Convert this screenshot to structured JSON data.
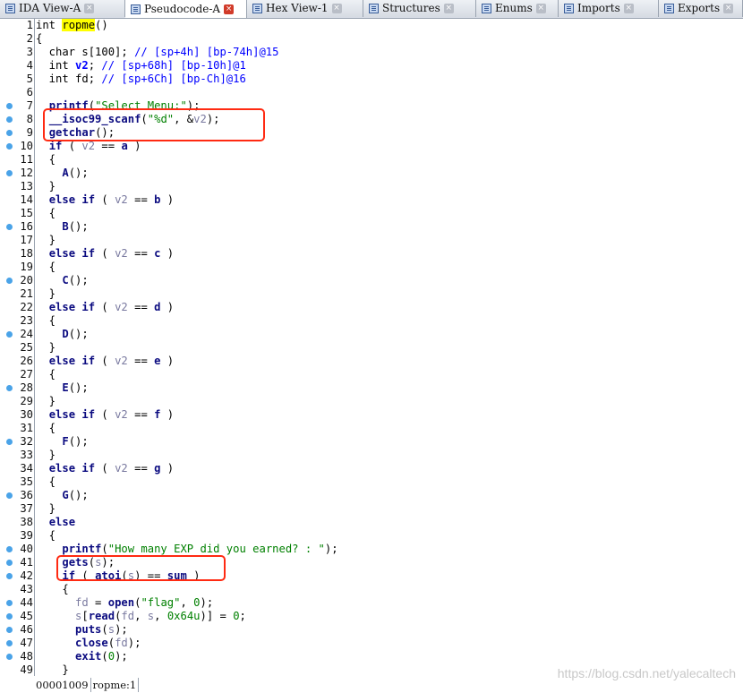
{
  "tabs": [
    {
      "label": "IDA View-A",
      "active": false,
      "icon": "ida-view-icon"
    },
    {
      "label": "Pseudocode-A",
      "active": true,
      "icon": "pseudocode-icon"
    },
    {
      "label": "Hex View-1",
      "active": false,
      "icon": "hex-view-icon"
    },
    {
      "label": "Structures",
      "active": false,
      "icon": "structures-icon"
    },
    {
      "label": "Enums",
      "active": false,
      "icon": "enums-icon"
    },
    {
      "label": "Imports",
      "active": false,
      "icon": "imports-icon"
    },
    {
      "label": "Exports",
      "active": false,
      "icon": "exports-icon"
    }
  ],
  "breakpoint_color": "#4aa3e8",
  "highlight_color": "#ff2a12",
  "lines": [
    {
      "n": "1",
      "dot": false,
      "code": [
        [
          "pn",
          "int "
        ],
        [
          "hl",
          "ropme"
        ],
        [
          "pn",
          "()"
        ]
      ]
    },
    {
      "n": "2",
      "dot": false,
      "code": [
        [
          "pn",
          "{"
        ]
      ]
    },
    {
      "n": "3",
      "dot": false,
      "code": [
        [
          "pn",
          "  char s[100]; "
        ],
        [
          "cmt",
          "// [sp+4h] [bp-74h]@15"
        ]
      ]
    },
    {
      "n": "4",
      "dot": false,
      "code": [
        [
          "pn",
          "  int "
        ],
        [
          "var",
          "v2"
        ],
        [
          "pn",
          "; "
        ],
        [
          "cmt",
          "// [sp+68h] [bp-10h]@1"
        ]
      ]
    },
    {
      "n": "5",
      "dot": false,
      "code": [
        [
          "pn",
          "  int fd; "
        ],
        [
          "cmt",
          "// [sp+6Ch] [bp-Ch]@16"
        ]
      ]
    },
    {
      "n": "6",
      "dot": false,
      "code": []
    },
    {
      "n": "7",
      "dot": true,
      "code": [
        [
          "pn",
          "  "
        ],
        [
          "fn",
          "printf"
        ],
        [
          "pn",
          "("
        ],
        [
          "str",
          "\"Select Menu:\""
        ],
        [
          "pn",
          ");"
        ]
      ]
    },
    {
      "n": "8",
      "dot": true,
      "code": [
        [
          "pn",
          "  "
        ],
        [
          "fn",
          "__isoc99_scanf"
        ],
        [
          "pn",
          "("
        ],
        [
          "str",
          "\"%d\""
        ],
        [
          "pn",
          ", &"
        ],
        [
          "lvar",
          "v2"
        ],
        [
          "pn",
          ");"
        ]
      ]
    },
    {
      "n": "9",
      "dot": true,
      "code": [
        [
          "pn",
          "  "
        ],
        [
          "fn",
          "getchar"
        ],
        [
          "pn",
          "();"
        ]
      ]
    },
    {
      "n": "10",
      "dot": true,
      "code": [
        [
          "pn",
          "  "
        ],
        [
          "kw",
          "if"
        ],
        [
          "pn",
          " ( "
        ],
        [
          "lvar",
          "v2"
        ],
        [
          "pn",
          " == "
        ],
        [
          "kw",
          "a"
        ],
        [
          "pn",
          " )"
        ]
      ]
    },
    {
      "n": "11",
      "dot": false,
      "code": [
        [
          "pn",
          "  {"
        ]
      ]
    },
    {
      "n": "12",
      "dot": true,
      "code": [
        [
          "pn",
          "    "
        ],
        [
          "fn",
          "A"
        ],
        [
          "pn",
          "();"
        ]
      ]
    },
    {
      "n": "13",
      "dot": false,
      "code": [
        [
          "pn",
          "  }"
        ]
      ]
    },
    {
      "n": "14",
      "dot": false,
      "code": [
        [
          "pn",
          "  "
        ],
        [
          "kw",
          "else if"
        ],
        [
          "pn",
          " ( "
        ],
        [
          "lvar",
          "v2"
        ],
        [
          "pn",
          " == "
        ],
        [
          "kw",
          "b"
        ],
        [
          "pn",
          " )"
        ]
      ]
    },
    {
      "n": "15",
      "dot": false,
      "code": [
        [
          "pn",
          "  {"
        ]
      ]
    },
    {
      "n": "16",
      "dot": true,
      "code": [
        [
          "pn",
          "    "
        ],
        [
          "fn",
          "B"
        ],
        [
          "pn",
          "();"
        ]
      ]
    },
    {
      "n": "17",
      "dot": false,
      "code": [
        [
          "pn",
          "  }"
        ]
      ]
    },
    {
      "n": "18",
      "dot": false,
      "code": [
        [
          "pn",
          "  "
        ],
        [
          "kw",
          "else if"
        ],
        [
          "pn",
          " ( "
        ],
        [
          "lvar",
          "v2"
        ],
        [
          "pn",
          " == "
        ],
        [
          "kw",
          "c"
        ],
        [
          "pn",
          " )"
        ]
      ]
    },
    {
      "n": "19",
      "dot": false,
      "code": [
        [
          "pn",
          "  {"
        ]
      ]
    },
    {
      "n": "20",
      "dot": true,
      "code": [
        [
          "pn",
          "    "
        ],
        [
          "fn",
          "C"
        ],
        [
          "pn",
          "();"
        ]
      ]
    },
    {
      "n": "21",
      "dot": false,
      "code": [
        [
          "pn",
          "  }"
        ]
      ]
    },
    {
      "n": "22",
      "dot": false,
      "code": [
        [
          "pn",
          "  "
        ],
        [
          "kw",
          "else if"
        ],
        [
          "pn",
          " ( "
        ],
        [
          "lvar",
          "v2"
        ],
        [
          "pn",
          " == "
        ],
        [
          "kw",
          "d"
        ],
        [
          "pn",
          " )"
        ]
      ]
    },
    {
      "n": "23",
      "dot": false,
      "code": [
        [
          "pn",
          "  {"
        ]
      ]
    },
    {
      "n": "24",
      "dot": true,
      "code": [
        [
          "pn",
          "    "
        ],
        [
          "fn",
          "D"
        ],
        [
          "pn",
          "();"
        ]
      ]
    },
    {
      "n": "25",
      "dot": false,
      "code": [
        [
          "pn",
          "  }"
        ]
      ]
    },
    {
      "n": "26",
      "dot": false,
      "code": [
        [
          "pn",
          "  "
        ],
        [
          "kw",
          "else if"
        ],
        [
          "pn",
          " ( "
        ],
        [
          "lvar",
          "v2"
        ],
        [
          "pn",
          " == "
        ],
        [
          "kw",
          "e"
        ],
        [
          "pn",
          " )"
        ]
      ]
    },
    {
      "n": "27",
      "dot": false,
      "code": [
        [
          "pn",
          "  {"
        ]
      ]
    },
    {
      "n": "28",
      "dot": true,
      "code": [
        [
          "pn",
          "    "
        ],
        [
          "fn",
          "E"
        ],
        [
          "pn",
          "();"
        ]
      ]
    },
    {
      "n": "29",
      "dot": false,
      "code": [
        [
          "pn",
          "  }"
        ]
      ]
    },
    {
      "n": "30",
      "dot": false,
      "code": [
        [
          "pn",
          "  "
        ],
        [
          "kw",
          "else if"
        ],
        [
          "pn",
          " ( "
        ],
        [
          "lvar",
          "v2"
        ],
        [
          "pn",
          " == "
        ],
        [
          "kw",
          "f"
        ],
        [
          "pn",
          " )"
        ]
      ]
    },
    {
      "n": "31",
      "dot": false,
      "code": [
        [
          "pn",
          "  {"
        ]
      ]
    },
    {
      "n": "32",
      "dot": true,
      "code": [
        [
          "pn",
          "    "
        ],
        [
          "fn",
          "F"
        ],
        [
          "pn",
          "();"
        ]
      ]
    },
    {
      "n": "33",
      "dot": false,
      "code": [
        [
          "pn",
          "  }"
        ]
      ]
    },
    {
      "n": "34",
      "dot": false,
      "code": [
        [
          "pn",
          "  "
        ],
        [
          "kw",
          "else if"
        ],
        [
          "pn",
          " ( "
        ],
        [
          "lvar",
          "v2"
        ],
        [
          "pn",
          " == "
        ],
        [
          "kw",
          "g"
        ],
        [
          "pn",
          " )"
        ]
      ]
    },
    {
      "n": "35",
      "dot": false,
      "code": [
        [
          "pn",
          "  {"
        ]
      ]
    },
    {
      "n": "36",
      "dot": true,
      "code": [
        [
          "pn",
          "    "
        ],
        [
          "fn",
          "G"
        ],
        [
          "pn",
          "();"
        ]
      ]
    },
    {
      "n": "37",
      "dot": false,
      "code": [
        [
          "pn",
          "  }"
        ]
      ]
    },
    {
      "n": "38",
      "dot": false,
      "code": [
        [
          "pn",
          "  "
        ],
        [
          "kw",
          "else"
        ]
      ]
    },
    {
      "n": "39",
      "dot": false,
      "code": [
        [
          "pn",
          "  {"
        ]
      ]
    },
    {
      "n": "40",
      "dot": true,
      "code": [
        [
          "pn",
          "    "
        ],
        [
          "fn",
          "printf"
        ],
        [
          "pn",
          "("
        ],
        [
          "str",
          "\"How many EXP did you earned? : \""
        ],
        [
          "pn",
          ");"
        ]
      ]
    },
    {
      "n": "41",
      "dot": true,
      "code": [
        [
          "pn",
          "    "
        ],
        [
          "fn",
          "gets"
        ],
        [
          "pn",
          "("
        ],
        [
          "lvar",
          "s"
        ],
        [
          "pn",
          ");"
        ]
      ]
    },
    {
      "n": "42",
      "dot": true,
      "code": [
        [
          "pn",
          "    "
        ],
        [
          "kw",
          "if"
        ],
        [
          "pn",
          " ( "
        ],
        [
          "fn",
          "atoi"
        ],
        [
          "pn",
          "("
        ],
        [
          "lvar",
          "s"
        ],
        [
          "pn",
          ") == "
        ],
        [
          "kw",
          "sum"
        ],
        [
          "pn",
          " )"
        ]
      ]
    },
    {
      "n": "43",
      "dot": false,
      "code": [
        [
          "pn",
          "    {"
        ]
      ]
    },
    {
      "n": "44",
      "dot": true,
      "code": [
        [
          "pn",
          "      "
        ],
        [
          "lvar",
          "fd"
        ],
        [
          "pn",
          " = "
        ],
        [
          "fn",
          "open"
        ],
        [
          "pn",
          "("
        ],
        [
          "str",
          "\"flag\""
        ],
        [
          "pn",
          ", "
        ],
        [
          "num",
          "0"
        ],
        [
          "pn",
          ");"
        ]
      ]
    },
    {
      "n": "45",
      "dot": true,
      "code": [
        [
          "pn",
          "      "
        ],
        [
          "lvar",
          "s"
        ],
        [
          "pn",
          "["
        ],
        [
          "fn",
          "read"
        ],
        [
          "pn",
          "("
        ],
        [
          "lvar",
          "fd"
        ],
        [
          "pn",
          ", "
        ],
        [
          "lvar",
          "s"
        ],
        [
          "pn",
          ", "
        ],
        [
          "num",
          "0x64u"
        ],
        [
          "pn",
          ")] = "
        ],
        [
          "num",
          "0"
        ],
        [
          "pn",
          ";"
        ]
      ]
    },
    {
      "n": "46",
      "dot": true,
      "code": [
        [
          "pn",
          "      "
        ],
        [
          "fn",
          "puts"
        ],
        [
          "pn",
          "("
        ],
        [
          "lvar",
          "s"
        ],
        [
          "pn",
          ");"
        ]
      ]
    },
    {
      "n": "47",
      "dot": true,
      "code": [
        [
          "pn",
          "      "
        ],
        [
          "fn",
          "close"
        ],
        [
          "pn",
          "("
        ],
        [
          "lvar",
          "fd"
        ],
        [
          "pn",
          ");"
        ]
      ]
    },
    {
      "n": "48",
      "dot": true,
      "code": [
        [
          "pn",
          "      "
        ],
        [
          "fn",
          "exit"
        ],
        [
          "pn",
          "("
        ],
        [
          "num",
          "0"
        ],
        [
          "pn",
          ");"
        ]
      ]
    },
    {
      "n": "49",
      "dot": false,
      "code": [
        [
          "pn",
          "    }"
        ]
      ]
    }
  ],
  "status": {
    "address": "00001009",
    "location": "ropme:1"
  },
  "watermark": "https://blog.csdn.net/yalecaltech"
}
